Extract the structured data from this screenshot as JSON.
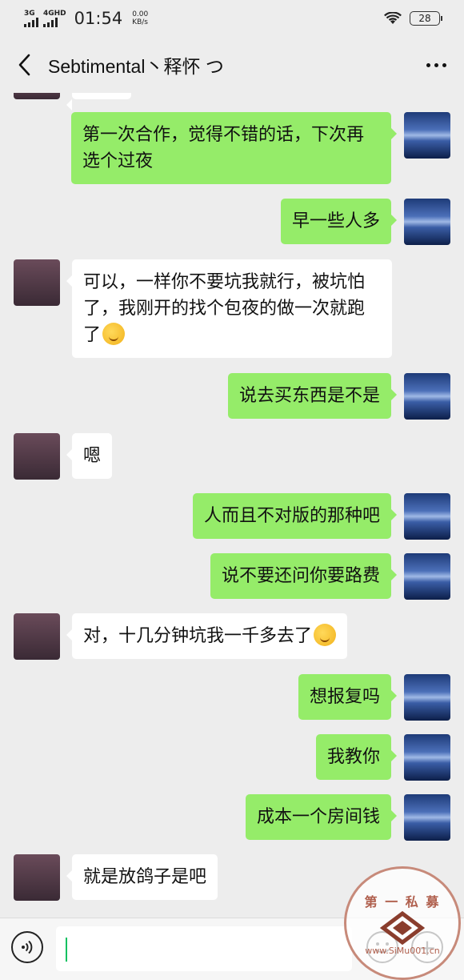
{
  "status_bar": {
    "network_1": "3G",
    "network_2": "4GHD",
    "time": "01:54",
    "speed_value": "0.00",
    "speed_unit": "KB/s",
    "battery": "28"
  },
  "header": {
    "title": "Sebtimental丶释怀 つ",
    "back_icon": "chevron-left-icon",
    "more_icon": "more-dots-icon"
  },
  "messages": [
    {
      "from": "self",
      "text": "第一次合作，觉得不错的话，下次再选个过夜"
    },
    {
      "from": "self",
      "text": "早一些人多"
    },
    {
      "from": "other",
      "text": "可以，一样你不要坑我就行，被坑怕了，我刚开的找个包夜的做一次就跑了",
      "emoji": "laugh-cry-emoji"
    },
    {
      "from": "self",
      "text": "说去买东西是不是"
    },
    {
      "from": "other",
      "text": "嗯"
    },
    {
      "from": "self",
      "text": "人而且不对版的那种吧"
    },
    {
      "from": "self",
      "text": "说不要还问你要路费"
    },
    {
      "from": "other",
      "text": "对，十几分钟坑我一千多去了",
      "emoji": "laugh-cry-emoji"
    },
    {
      "from": "self",
      "text": "想报复吗"
    },
    {
      "from": "self",
      "text": "我教你"
    },
    {
      "from": "self",
      "text": "成本一个房间钱"
    },
    {
      "from": "other",
      "text": "就是放鸽子是吧"
    }
  ],
  "input_bar": {
    "voice_icon": "voice-icon",
    "input_value": "",
    "emoji_icon": "smiley-icon",
    "plus_icon": "plus-icon"
  },
  "watermark": {
    "text_top": "第 一 私 募",
    "text_bottom": "www.SiMu001.cn"
  },
  "colors": {
    "self_bubble": "#95ec69",
    "other_bubble": "#ffffff",
    "background": "#ededed",
    "cursor": "#07c160"
  }
}
